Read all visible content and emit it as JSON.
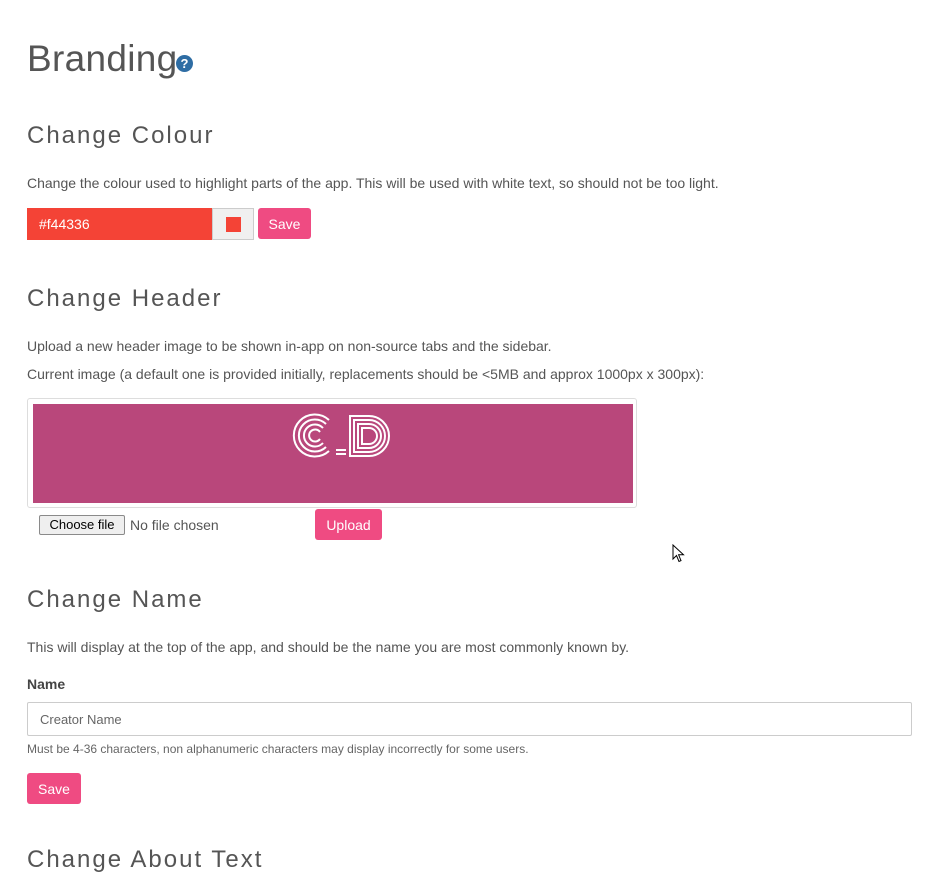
{
  "page": {
    "title": "Branding",
    "help_glyph": "?"
  },
  "colour": {
    "heading": "Change Colour",
    "description": "Change the colour used to highlight parts of the app. This will be used with white text, so should not be too light.",
    "value": "#f44336",
    "swatch_color": "#f44336",
    "save_label": "Save"
  },
  "header": {
    "heading": "Change Header",
    "description": "Upload a new header image to be shown in-app on non-source tabs and the sidebar.",
    "current_note": "Current image (a default one is provided initially, replacements should be <5MB and approx 1000px x 300px):",
    "image_bg": "#b9477b",
    "choose_file_label": "Choose file",
    "file_status": "No file chosen",
    "upload_label": "Upload"
  },
  "name": {
    "heading": "Change Name",
    "description": "This will display at the top of the app, and should be the name you are most commonly known by.",
    "label": "Name",
    "placeholder": "Creator Name",
    "help": "Must be 4-36 characters, non alphanumeric characters may display incorrectly for some users.",
    "save_label": "Save"
  },
  "about": {
    "heading": "Change About Text"
  },
  "colors": {
    "accent": "#ef4b82",
    "help_icon": "#2e6da4"
  }
}
